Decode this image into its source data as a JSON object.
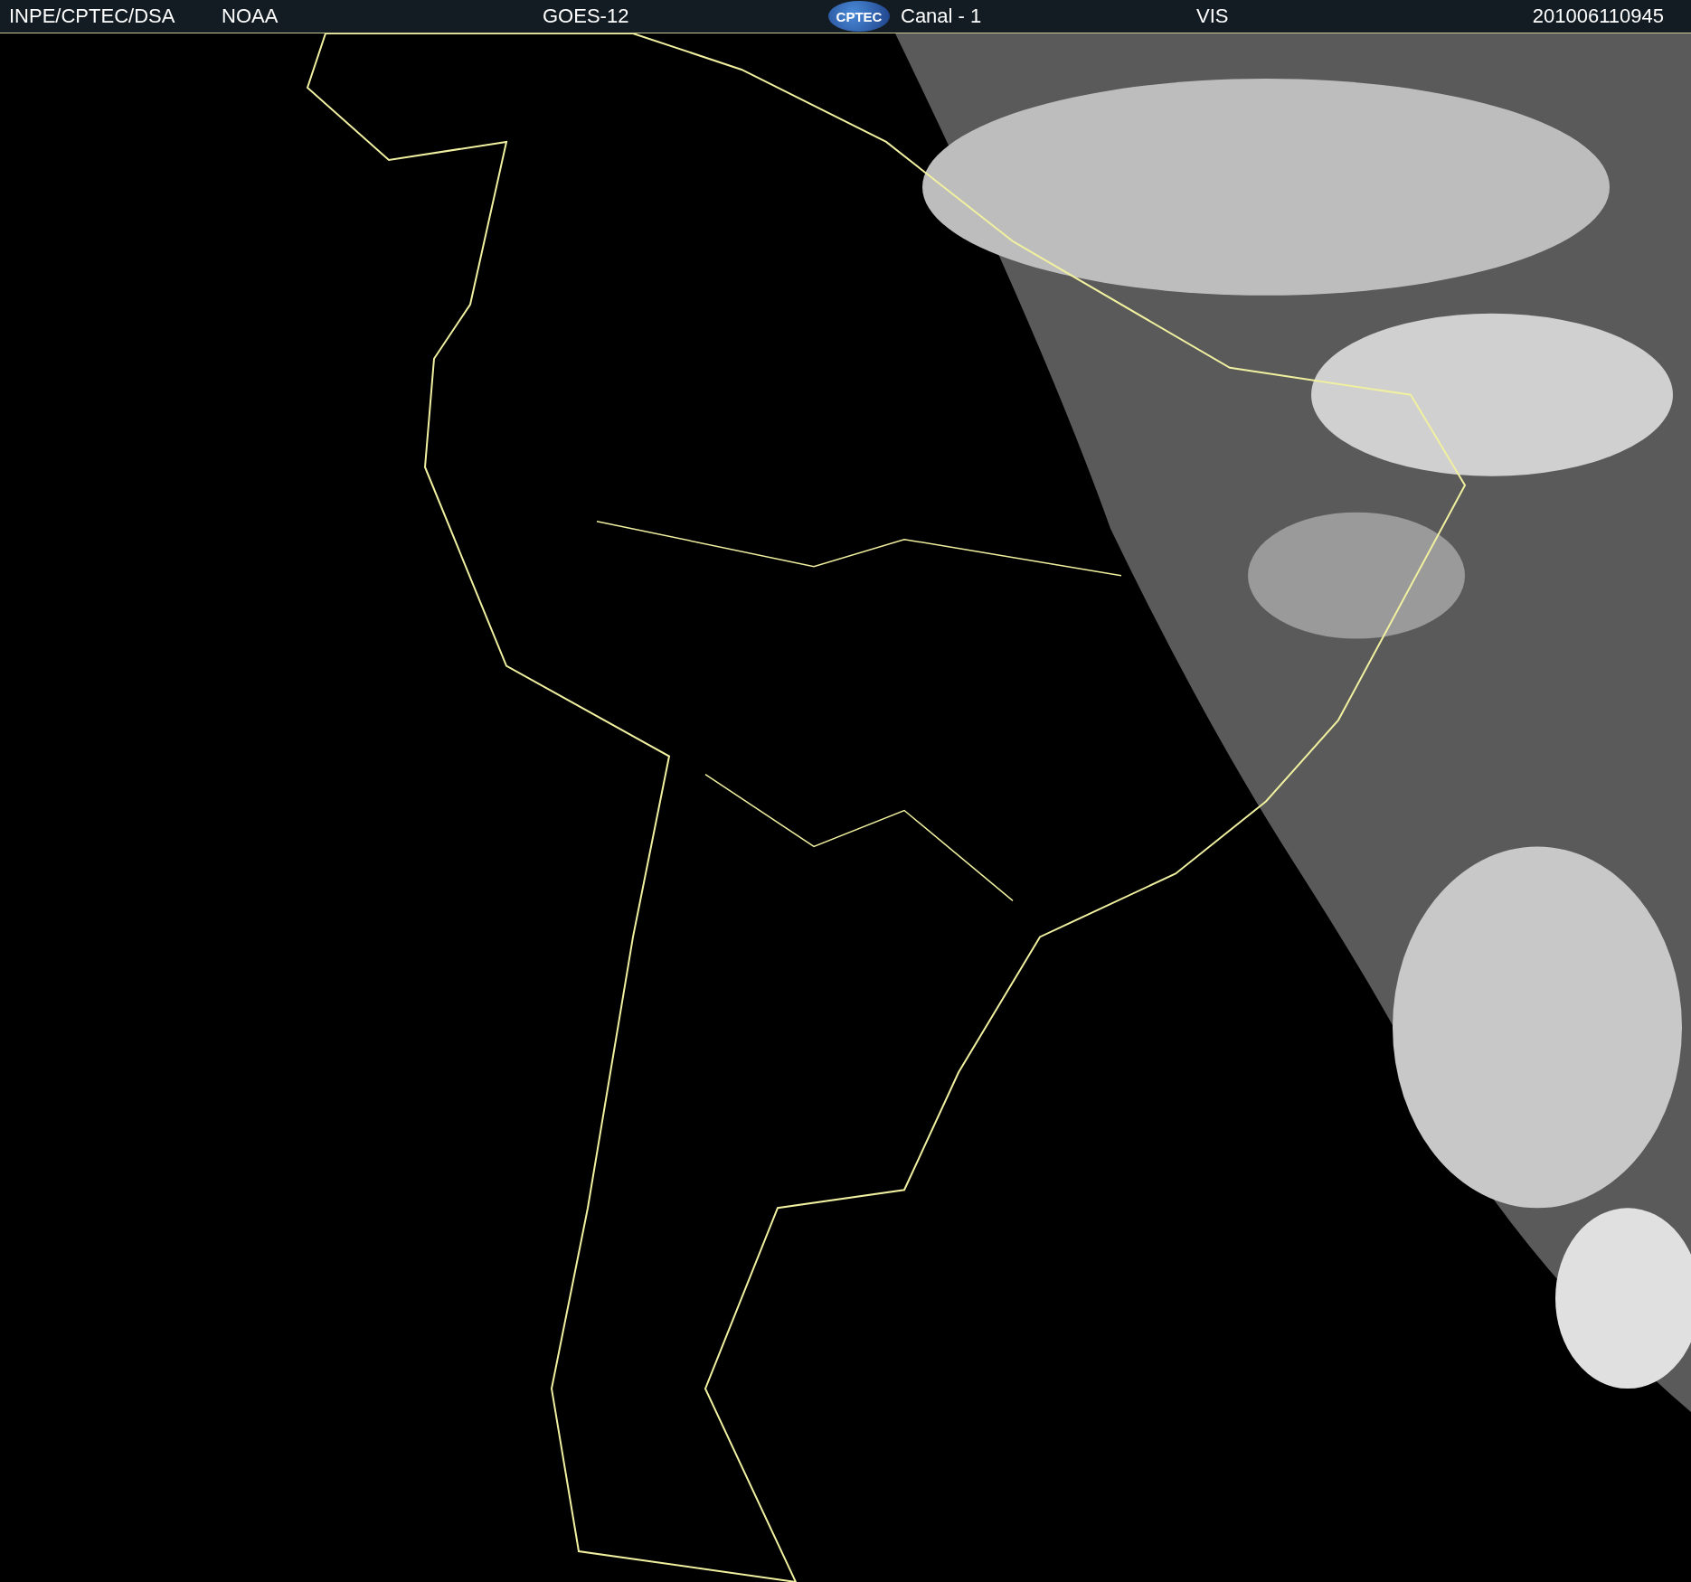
{
  "header": {
    "items": [
      {
        "kind": "text",
        "text": "INPE/CPTEC/DSA"
      },
      {
        "kind": "text",
        "text": "NOAA"
      },
      {
        "kind": "text",
        "text": "GOES-12"
      },
      {
        "kind": "logo",
        "text": "CPTEC"
      },
      {
        "kind": "text",
        "text": "Canal - 1"
      },
      {
        "kind": "text",
        "text": "VIS"
      },
      {
        "kind": "text",
        "text": "201006110945"
      }
    ]
  }
}
